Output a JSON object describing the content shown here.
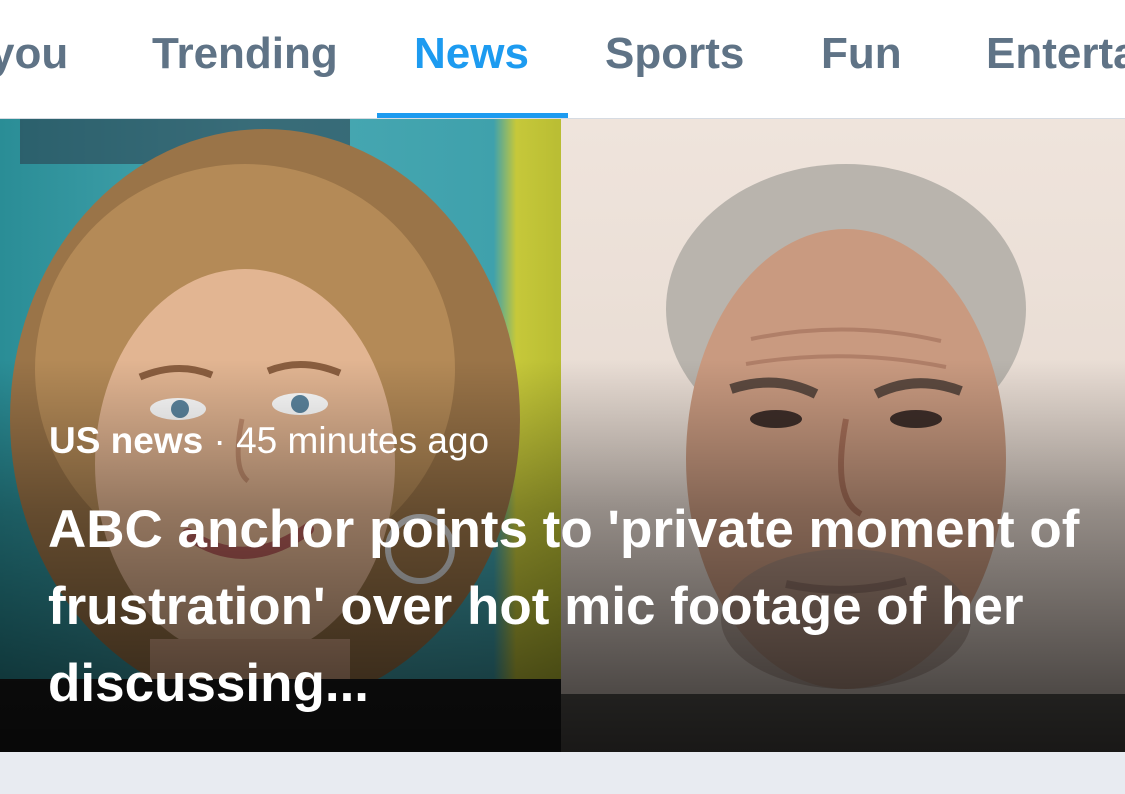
{
  "tabs": [
    {
      "label": "you",
      "active": false
    },
    {
      "label": "Trending",
      "active": false
    },
    {
      "label": "News",
      "active": true
    },
    {
      "label": "Sports",
      "active": false
    },
    {
      "label": "Fun",
      "active": false
    },
    {
      "label": "Enterta",
      "active": false
    }
  ],
  "story": {
    "source": "US news",
    "separator": "·",
    "time": "45 minutes ago",
    "headline": "ABC anchor points to 'private moment of frustration' over hot mic footage of her discussing..."
  },
  "colors": {
    "accent": "#1d9bf0",
    "tab_inactive": "#5f7386",
    "background": "#e8ebf1"
  }
}
